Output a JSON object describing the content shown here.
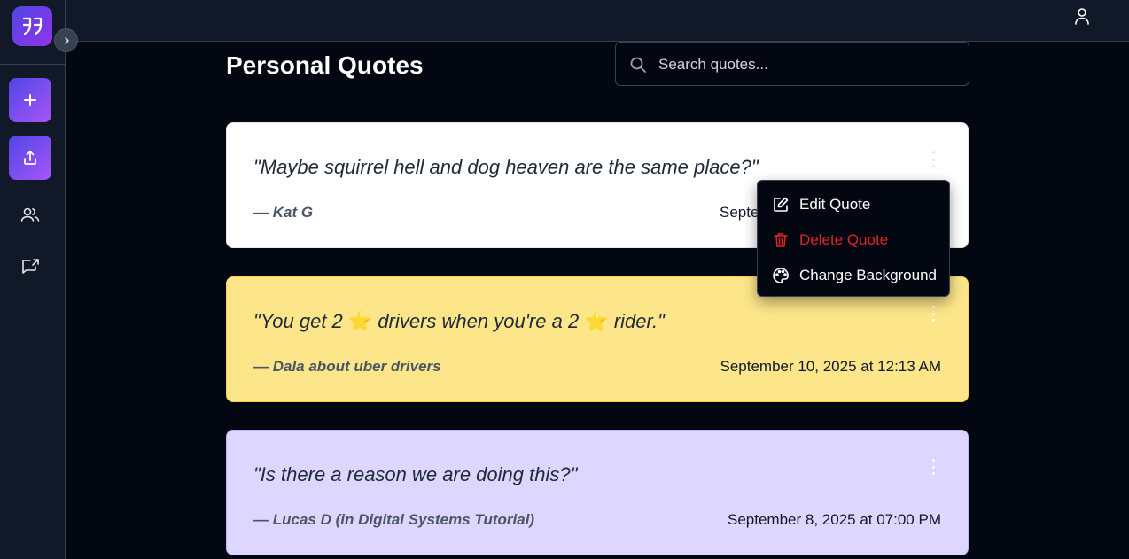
{
  "sidebar": {
    "logo_icon": "quote-icon",
    "items": [
      {
        "name": "add",
        "icon": "plus-icon"
      },
      {
        "name": "share",
        "icon": "upload-icon"
      },
      {
        "name": "friends",
        "icon": "users-icon"
      },
      {
        "name": "shared-quotes",
        "icon": "message-share-icon"
      }
    ]
  },
  "topbar": {
    "user_icon": "user-icon"
  },
  "page": {
    "title": "Personal Quotes",
    "search_placeholder": "Search quotes..."
  },
  "quotes": [
    {
      "text": "\"Maybe squirrel hell and dog heaven are the same place?\"",
      "author": "— Kat G",
      "date": "September",
      "date_visible": "Septe",
      "background": "#ffffff"
    },
    {
      "text_parts": [
        "\"You get 2 ",
        "⭐",
        " drivers when you're a 2 ",
        "⭐",
        " rider.\""
      ],
      "author": "— Dala about uber drivers",
      "date": "September 10, 2025 at 12:13 AM",
      "background": "#fde68a"
    },
    {
      "text": "\"Is there a reason we are doing this?\"",
      "author": "— Lucas D (in Digital Systems Tutorial)",
      "date": "September 8, 2025 at 07:00 PM",
      "background": "#ddd6fe"
    }
  ],
  "menu": {
    "edit_label": "Edit Quote",
    "delete_label": "Delete Quote",
    "background_label": "Change Background",
    "delete_color": "#dc2626"
  },
  "colors": {
    "accent_start": "#4f46e5",
    "accent_end": "#a855f7",
    "background": "#030712",
    "panel": "#111827"
  }
}
